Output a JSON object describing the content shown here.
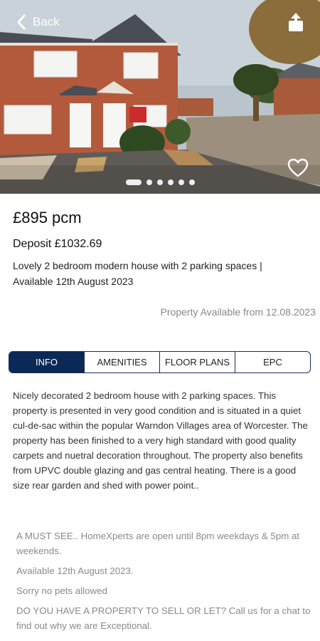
{
  "header": {
    "back_label": "Back",
    "image_dots": 6,
    "active_dot": 0
  },
  "listing": {
    "price": "£895 pcm",
    "deposit": "Deposit £1032.69",
    "summary": "Lovely 2 bedroom modern house with 2 parking spaces | Available 12th August 2023",
    "available": "Property Available from 12.08.2023"
  },
  "tabs": [
    {
      "label": "INFO",
      "active": true
    },
    {
      "label": "AMENITIES",
      "active": false
    },
    {
      "label": "FLOOR PLANS",
      "active": false
    },
    {
      "label": "EPC",
      "active": false
    }
  ],
  "description": "Nicely decorated 2 bedroom house with 2 parking spaces. This property is presented in very good condition and is situated in a quiet cul-de-sac within the popular Warndon Villages area of Worcester. The property has been finished to a very high standard with good quality carpets and nuetral decoration throughout. The property also benefits from UPVC double glazing and gas central heating. There is a good size rear garden and shed with power point..",
  "notes": [
    "A MUST SEE.. HomeXperts are open until 8pm weekdays & 5pm at weekends.",
    "Available 12th August 2023.",
    "Sorry no pets allowed",
    "DO YOU HAVE A PROPERTY TO SELL OR LET? Call us for a chat to find out why we are Exceptional."
  ],
  "colors": {
    "accent": "#0b2957",
    "muted_text": "#8a8a8a"
  }
}
